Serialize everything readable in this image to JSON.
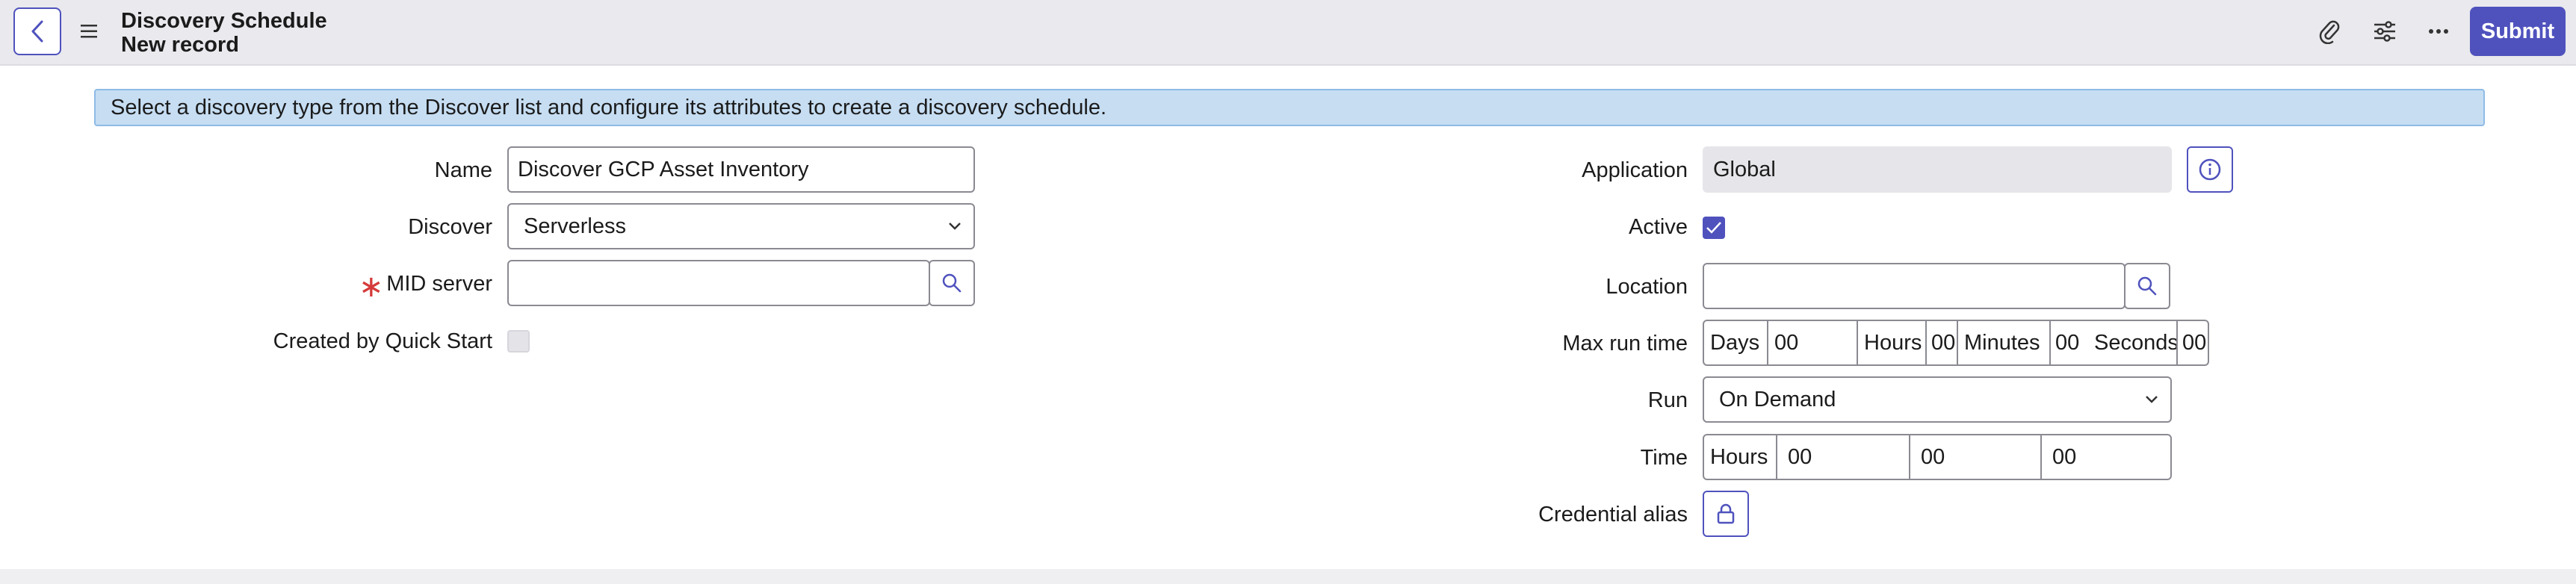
{
  "header": {
    "title": "Discovery Schedule",
    "subtitle": "New record",
    "submit_label": "Submit"
  },
  "banner": {
    "text": "Select a discovery type from the Discover list and configure its attributes to create a discovery schedule."
  },
  "left": {
    "name_label": "Name",
    "name_value": "Discover GCP Asset Inventory",
    "discover_label": "Discover",
    "discover_value": "Serverless",
    "mid_label": "MID server",
    "mid_required": "∗",
    "mid_value": "",
    "quickstart_label": "Created by Quick Start",
    "quickstart_checked": false
  },
  "right": {
    "application_label": "Application",
    "application_value": "Global",
    "active_label": "Active",
    "active_checked": true,
    "location_label": "Location",
    "location_value": "",
    "maxrun_label": "Max run time",
    "maxrun": {
      "days_label": "Days",
      "days_value": "00",
      "hours_label": "Hours",
      "hours_value": "00",
      "minutes_label": "Minutes",
      "minutes_value": "00",
      "seconds_label": "Seconds",
      "seconds_value": "00"
    },
    "run_label": "Run",
    "run_value": "On Demand",
    "time_label": "Time",
    "time": {
      "hours_label": "Hours",
      "hours_value": "00",
      "minutes_value": "00",
      "seconds_value": "00"
    },
    "credential_label": "Credential alias"
  },
  "colors": {
    "accent": "#4f52bd",
    "banner_bg": "#c6ddf2",
    "required": "#d63a3a"
  },
  "icons": [
    "chevron-left-icon",
    "hamburger-menu-icon",
    "paperclip-icon",
    "sliders-icon",
    "more-icon",
    "search-icon",
    "info-icon",
    "checkmark-icon",
    "lock-icon",
    "chevron-down-icon"
  ]
}
